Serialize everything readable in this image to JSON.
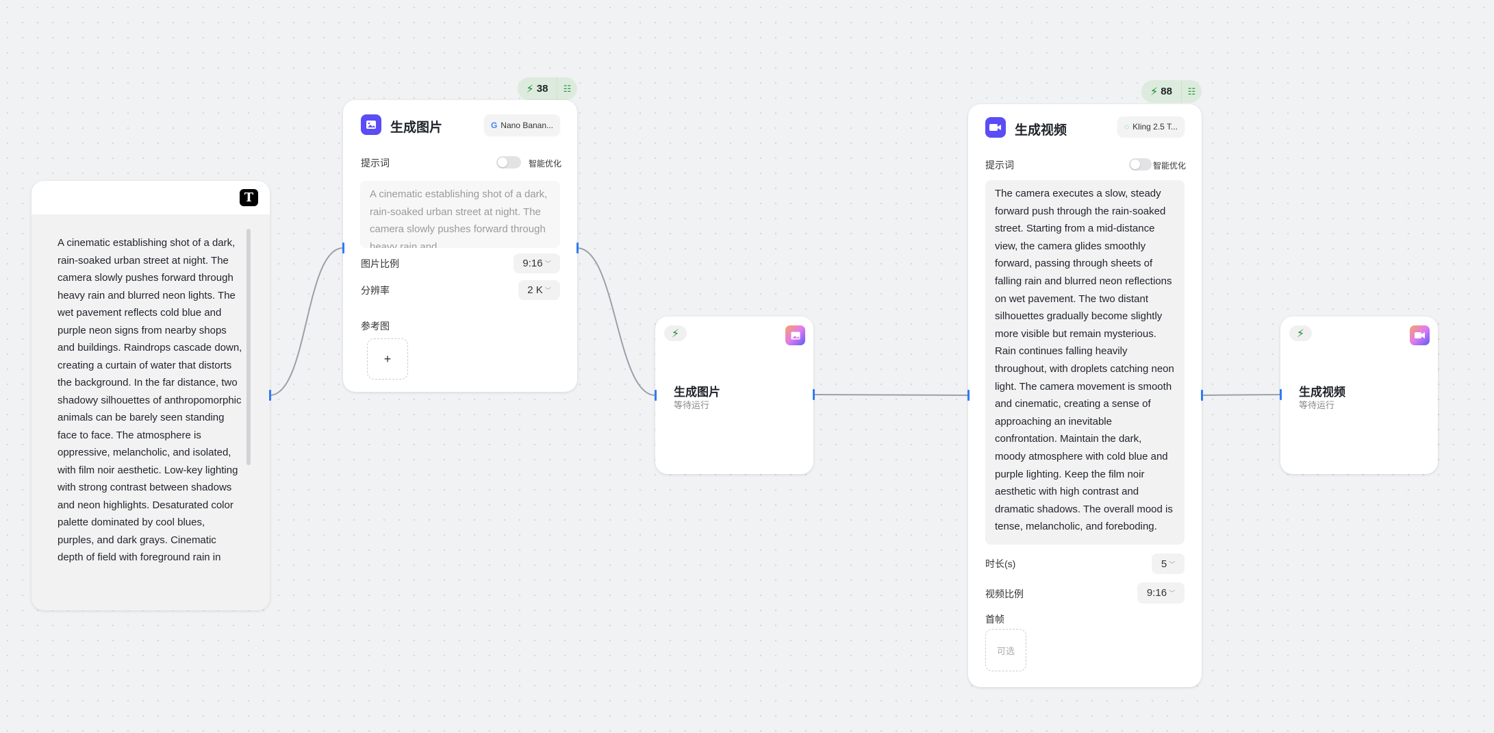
{
  "text_node": {
    "icon": "text-T-icon",
    "content": "A cinematic establishing shot of a dark, rain-soaked urban street at night. The camera slowly pushes forward through heavy rain and blurred neon lights. The wet pavement reflects cold blue and purple neon signs from nearby shops and buildings. Raindrops cascade down, creating a curtain of water that distorts the background. In the far distance, two shadowy silhouettes of anthropomorphic animals can be barely seen standing face to face. The atmosphere is oppressive, melancholic, and isolated, with film noir aesthetic. Low-key lighting with strong contrast between shadows and neon highlights. Desaturated color palette dominated by cool blues, purples, and dark grays. Cinematic depth of field with foreground rain in"
  },
  "image_node": {
    "cost": "38",
    "title": "生成图片",
    "model": "Nano Banan...",
    "prompt_label": "提示词",
    "optimize_label": "智能优化",
    "optimize_on": false,
    "prompt": "A cinematic establishing shot of a dark, rain-soaked urban street at night. The camera slowly pushes forward through heavy rain and",
    "ratio_label": "图片比例",
    "ratio": "9:16",
    "resolution_label": "分辨率",
    "resolution": "2 K",
    "reference_label": "参考图",
    "add": "+"
  },
  "image_result": {
    "title": "生成图片",
    "status": "等待运行"
  },
  "video_node": {
    "cost": "88",
    "title": "生成视频",
    "model": "Kling 2.5 T...",
    "prompt_label": "提示词",
    "optimize_label": "智能优化",
    "optimize_on": false,
    "prompt": "The camera executes a slow, steady forward push through the rain-soaked street. Starting from a mid-distance view, the camera glides smoothly forward, passing through sheets of falling rain and blurred neon reflections on wet pavement. The two distant silhouettes gradually become slightly more visible but remain mysterious. Rain continues falling heavily throughout, with droplets catching neon light. The camera movement is smooth and cinematic, creating a sense of approaching an inevitable confrontation. Maintain the dark, moody atmosphere with cold blue and purple lighting. Keep the film noir aesthetic with high contrast and dramatic shadows. The overall mood is tense, melancholic, and foreboding.",
    "duration_label": "时长(s)",
    "duration": "5",
    "ratio_label": "视频比例",
    "ratio": "9:16",
    "first_frame_label": "首帧",
    "first_frame_placeholder": "可选"
  },
  "video_result": {
    "title": "生成视频",
    "status": "等待运行"
  },
  "colors": {
    "accent": "#5b4cf5",
    "handle": "#2f7bf6",
    "cost_badge": "#dcebdd",
    "bolt": "#1a8a2e"
  }
}
